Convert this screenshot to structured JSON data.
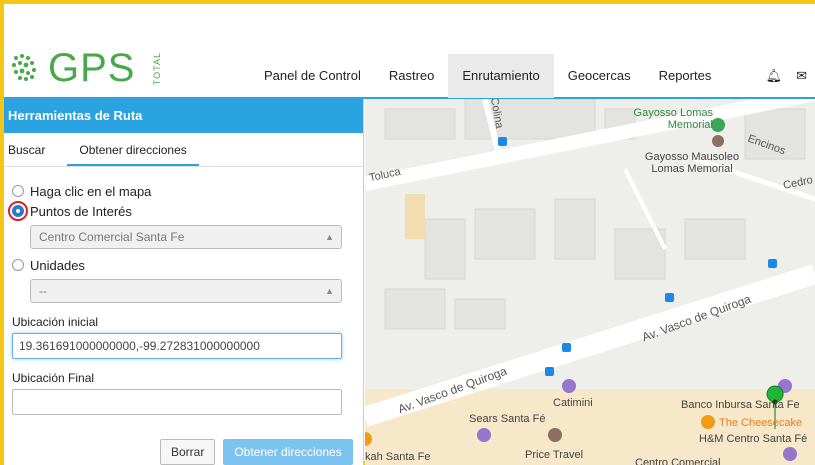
{
  "header": {
    "logo_text": "GPS",
    "logo_sub": "TOTAL",
    "nav": [
      "Panel de Control",
      "Rastreo",
      "Enrutamiento",
      "Geocercas",
      "Reportes"
    ],
    "active_nav": "Enrutamiento"
  },
  "panel": {
    "title": "Herramientas de Ruta",
    "tabs": [
      "Buscar",
      "Obtener direcciones"
    ],
    "radio_map": "Haga clic en el mapa",
    "radio_poi": "Puntos de Interés",
    "poi_select": "Centro Comercial Santa Fe",
    "radio_units": "Unidades",
    "units_select": "--",
    "start_label": "Ubicación inicial",
    "start_value": "19.361691000000000,-99.272831000000000",
    "end_label": "Ubicación Final",
    "end_value": "",
    "btn_clear": "Borrar",
    "btn_get": "Obtener direcciones"
  },
  "map": {
    "labels": {
      "colina": "Colina",
      "toluca": "Toluca",
      "gayosso_lomas": "Gayosso Lomas Memorial",
      "gayosso_mausoleo": "Gayosso Mausoleo Lomas Memorial",
      "encinos": "Encinos",
      "cedro": "Cedro",
      "vasco1": "Av. Vasco de Quiroga",
      "vasco2": "Av. Vasco de Quiroga",
      "catimini": "Catimini",
      "sears": "Sears Santa Fé",
      "banco": "Banco Inbursa Santa Fe",
      "cheesecake": "The Cheesecake",
      "hm": "H&M Centro Santa Fé",
      "price": "Price Travel",
      "centro": "Centro Comercial",
      "kah": "kah Santa Fe"
    }
  }
}
